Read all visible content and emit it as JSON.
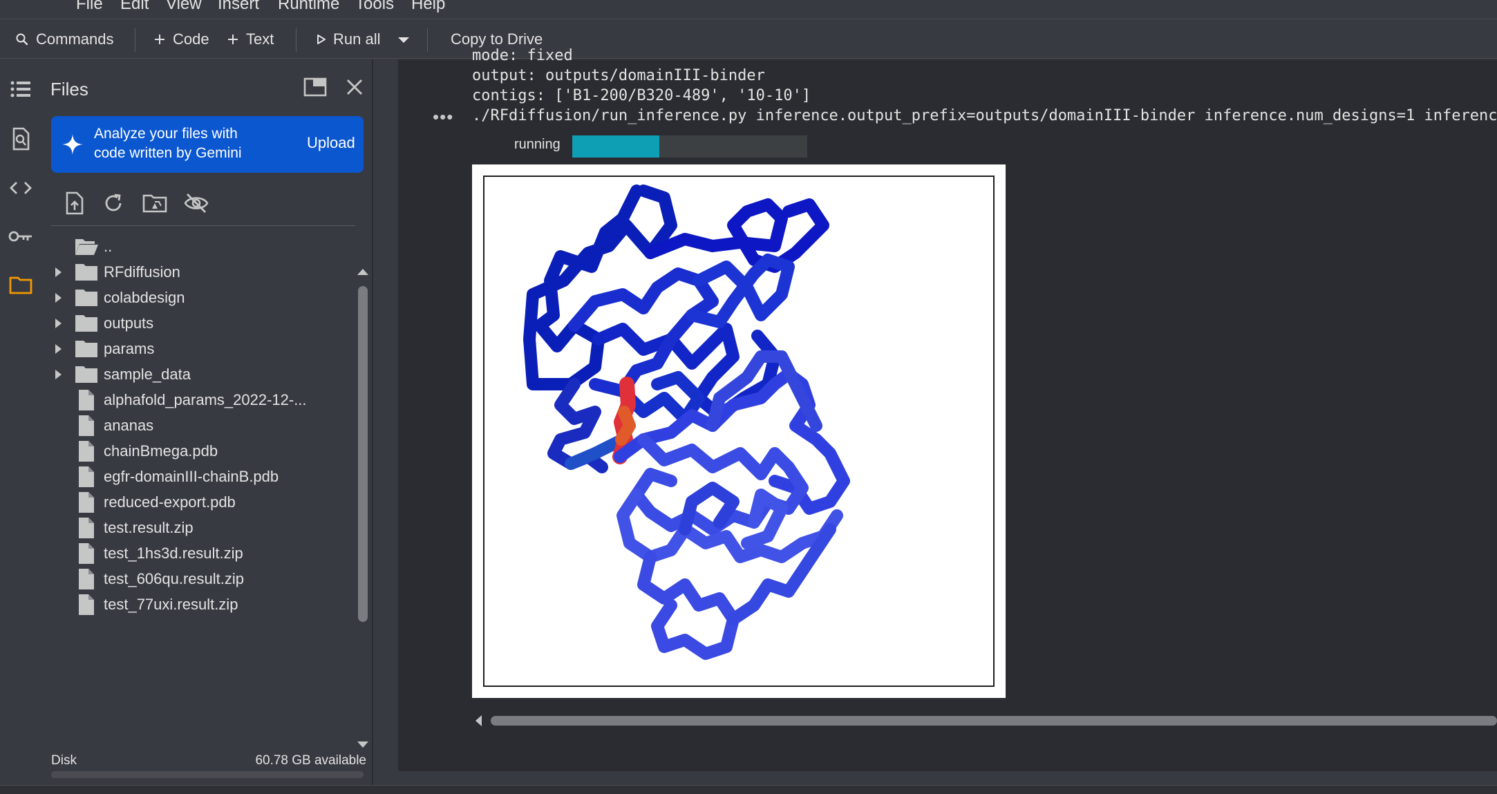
{
  "menu": {
    "items": [
      "File",
      "Edit",
      "View",
      "Insert",
      "Runtime",
      "Tools",
      "Help"
    ]
  },
  "toolbar": {
    "commands_label": "Commands",
    "code_label": "Code",
    "text_label": "Text",
    "run_all_label": "Run all",
    "copy_to_drive_label": "Copy to Drive"
  },
  "rail": {
    "icons": [
      "table-of-contents-icon",
      "find-replace-icon",
      "code-snippets-icon",
      "secrets-key-icon",
      "files-folder-icon"
    ]
  },
  "files_panel": {
    "title": "Files",
    "banner": {
      "text": "Analyze your files with code written by Gemini",
      "upload_label": "Upload"
    },
    "tree": [
      {
        "name": "..",
        "kind": "parent"
      },
      {
        "name": "RFdiffusion",
        "kind": "folder"
      },
      {
        "name": "colabdesign",
        "kind": "folder"
      },
      {
        "name": "outputs",
        "kind": "folder"
      },
      {
        "name": "params",
        "kind": "folder"
      },
      {
        "name": "sample_data",
        "kind": "folder"
      },
      {
        "name": "alphafold_params_2022-12-...",
        "kind": "file"
      },
      {
        "name": "ananas",
        "kind": "file"
      },
      {
        "name": "chainBmega.pdb",
        "kind": "file"
      },
      {
        "name": "egfr-domainIII-chainB.pdb",
        "kind": "file"
      },
      {
        "name": "reduced-export.pdb",
        "kind": "file"
      },
      {
        "name": "test.result.zip",
        "kind": "file"
      },
      {
        "name": "test_1hs3d.result.zip",
        "kind": "file"
      },
      {
        "name": "test_606qu.result.zip",
        "kind": "file"
      },
      {
        "name": "test_77uxi.result.zip",
        "kind": "file"
      }
    ],
    "disk": {
      "label": "Disk",
      "available": "60.78 GB available"
    }
  },
  "output": {
    "lines": [
      "mode: fixed",
      "output: outputs/domainIII-binder",
      "contigs: ['B1-200/B320-489', '10-10']",
      "./RFdiffusion/run_inference.py inference.output_prefix=outputs/domainIII-binder inference.num_designs=1 inference"
    ],
    "status_label": "running",
    "progress_fraction": 0.37
  },
  "colors": {
    "accent": "#0b57d0",
    "progress_fill": "#0e9fb5",
    "files_active": "#f29900"
  }
}
